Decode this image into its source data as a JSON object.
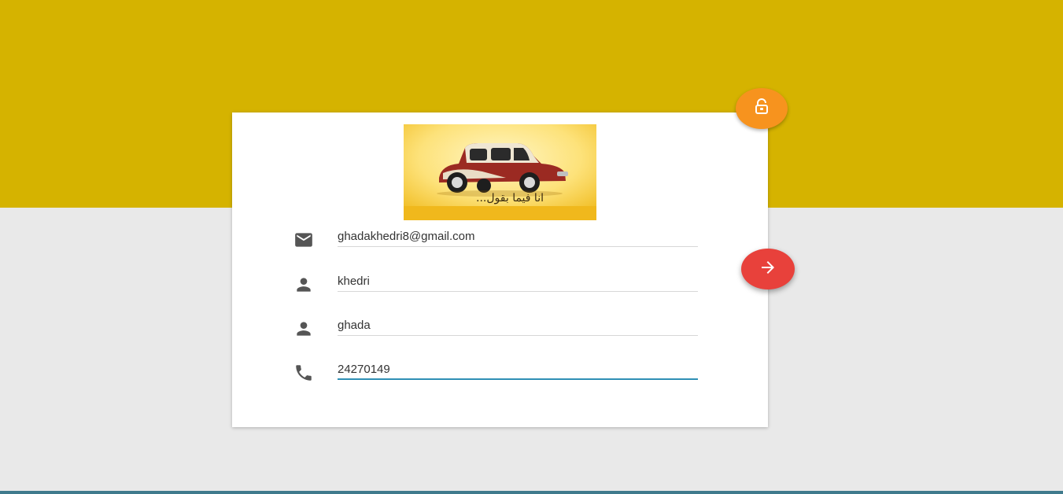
{
  "logo": {
    "caption": "انا فيما بقول..."
  },
  "form": {
    "email": "ghadakhedri8@gmail.com",
    "last_name": "khedri",
    "first_name": "ghada",
    "phone": "24270149"
  },
  "icons": {
    "email": "email-icon",
    "last_name": "person-icon",
    "first_name": "person-icon",
    "phone": "phone-icon",
    "lock": "lock-icon",
    "next": "arrow-right-icon"
  },
  "colors": {
    "header": "#d5b300",
    "background": "#e9e9e9",
    "lock_fab": "#f7931e",
    "next_fab": "#e8413b",
    "active_underline": "#2f8fb5"
  }
}
